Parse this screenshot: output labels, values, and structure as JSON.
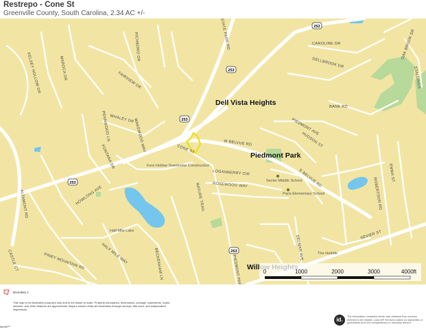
{
  "header": {
    "title": "Restrepo - Cone St",
    "subtitle": "Greenville County, South Carolina, 2.34 AC +/-"
  },
  "map": {
    "colors": {
      "land": "#f2e5a4",
      "road": "#ffffff",
      "water": "#74c6ec",
      "park": "#b7d99a",
      "boundary": "#e9e21a"
    },
    "places": [
      "Dell Vista Heights",
      "Piedmont Park",
      "Willow Heights"
    ],
    "streets": [
      "MAROCA DR",
      "RICHBORO DR",
      "FAIRVIEW DR",
      "KELSEY HOLLOW DR",
      "STATE PARK RD",
      "CAROLINE DR",
      "DELLBROOK DR",
      "OAK BROOK DR",
      "STALLINGS",
      "BANE RD",
      "WHALEY DR",
      "PENNWOOD LN",
      "WAKEWOOD WAY",
      "FONTANA DR",
      "PIEDMONT AVE",
      "W BELVUE RD",
      "CONE ST",
      "HUDSON ST",
      "ALTAMONT RD",
      "LOGANBERRY CIR",
      "ROSEWOOD WAY",
      "E BELVUE RD",
      "ROBERTSON RD",
      "EMMA ST",
      "HOWLONG AVE",
      "NATURE TRAIL",
      "HALF MILE WAY",
      "BECKENHAM LN",
      "CASTLE CT",
      "PINEY MOUNTAIN RD",
      "DELMAR AVE",
      "SEVIER ST",
      "PIEDMONT PARK RD"
    ],
    "shields": [
      "253",
      "253",
      "253",
      "253",
      "253"
    ],
    "pois": [
      "Fern Hollow Townhome Construction",
      "Half Mile Lake",
      "Sevier Middle School",
      "Paris Elementary School",
      "The Heddle"
    ],
    "scale": {
      "labels": [
        "0",
        "1000",
        "2000",
        "3000",
        "4000ft"
      ]
    }
  },
  "footer": {
    "legend_label": "Boundary 1",
    "disclaimer": "This map is for illustrative purposes only and is not drawn to scale. Property boundaries, dimensions, acreage, easements, roads, streams, and other features are approximate. Buyers should verify all information through surveys, title work, and independent inspections.",
    "brand_logo": "id.",
    "brand_note": "The information contained herein was obtained from sources deemed to be reliable. Land id® Services makes no warranties or guarantees as to the completeness or accuracy thereof.",
    "footer_logo": "landid™"
  }
}
